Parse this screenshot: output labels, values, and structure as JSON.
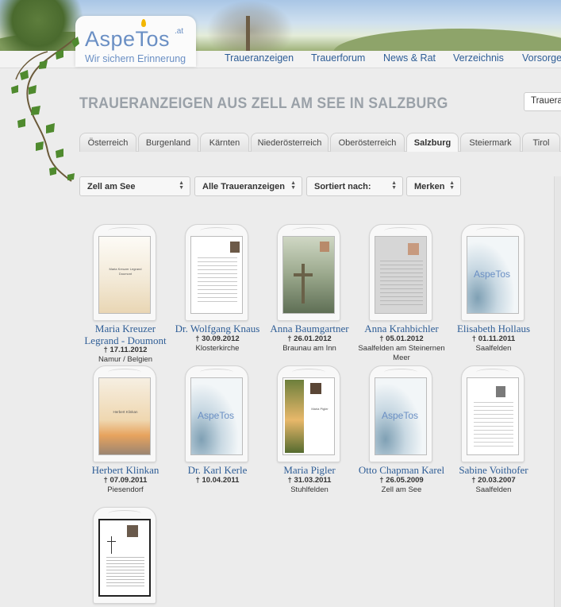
{
  "logo": {
    "name": "AspeTos",
    "tld": ".at",
    "slogan": "Wir sichern Erinnerung"
  },
  "nav": [
    "Traueranzeigen",
    "Trauerforum",
    "News & Rat",
    "Verzeichnis",
    "Vorsorge"
  ],
  "page_title": "Traueranzeigen aus Zell am See in Salzburg",
  "search_value": "Trauera",
  "tabs": [
    "Österreich",
    "Burgenland",
    "Kärnten",
    "Niederösterreich",
    "Oberösterreich",
    "Salzburg",
    "Steiermark",
    "Tirol"
  ],
  "active_tab": "Salzburg",
  "filters": [
    "Zell am See",
    "Alle Traueranzeigen",
    "Sortiert nach:",
    "Merken"
  ],
  "icons": {
    "filter_arrows": "up-down-arrows-icon",
    "vine": "ivy-vine-icon"
  },
  "colors": {
    "link": "#2e5d96",
    "title": "#9aa1a8",
    "logo": "#6a8fc4",
    "flame": "#f2b600"
  },
  "obituaries": [
    {
      "name": "Maria Kreuzer Legrand - Doumont",
      "date": "† 17.11.2012",
      "place": "Namur / Belgien",
      "thumb": "sunset-card"
    },
    {
      "name": "Dr. Wolfgang Knaus",
      "date": "† 30.09.2012",
      "place": "Klosterkirche",
      "thumb": "photo-letter"
    },
    {
      "name": "Anna Baumgartner",
      "date": "† 26.01.2012",
      "place": "Braunau am Inn",
      "thumb": "cross-landscape"
    },
    {
      "name": "Anna Krahbichler",
      "date": "† 05.01.2012",
      "place": "Saalfelden am Steinernen Meer",
      "thumb": "faded-photo"
    },
    {
      "name": "Elisabeth Hollaus",
      "date": "† 01.11.2011",
      "place": "Saalfelden",
      "thumb": "aspetos-logo"
    },
    {
      "name": "Herbert Klinkan",
      "date": "† 07.09.2011",
      "place": "Piesendorf",
      "thumb": "sunset-sea"
    },
    {
      "name": "Dr. Karl Kerle",
      "date": "† 10.04.2011",
      "place": "",
      "thumb": "aspetos-logo"
    },
    {
      "name": "Maria Pigler",
      "date": "† 31.03.2011",
      "place": "Stuhlfelden",
      "thumb": "sunbeam-forest"
    },
    {
      "name": "Otto Chapman Karel",
      "date": "† 26.05.2009",
      "place": "Zell am See",
      "thumb": "aspetos-logo"
    },
    {
      "name": "Sabine Voithofer",
      "date": "† 20.03.2007",
      "place": "Saalfelden",
      "thumb": "photo-letter-plain"
    },
    {
      "name": "",
      "date": "",
      "place": "",
      "thumb": "bordered-letter"
    }
  ],
  "thumb_logo_text": "AspeTos",
  "thumb_small_texts": {
    "t1": "Maria Kreuzer Legrand",
    "t1b": "Doumont",
    "t4": "Herbert Klinkan",
    "t8": "Maria Pigler"
  }
}
